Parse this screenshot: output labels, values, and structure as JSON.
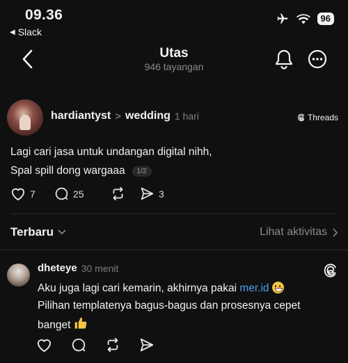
{
  "status_bar": {
    "time": "09.36",
    "back_app": "Slack",
    "battery": "96",
    "icons": [
      "airplane-icon",
      "wifi-icon",
      "battery-icon"
    ]
  },
  "nav": {
    "title": "Utas",
    "subtitle": "946 tayangan",
    "icons": [
      "back-chevron-icon",
      "bell-icon",
      "more-icon"
    ]
  },
  "post": {
    "username": "hardiantyst",
    "separator": ">",
    "topic": "wedding",
    "time_ago": "1 hari",
    "badge": "Threads",
    "line1": "Lagi cari jasa untuk undangan digital nihh,",
    "line2": "Spal spill dong wargaaa",
    "page_indicator": "1/2",
    "likes": "7",
    "comments": "25",
    "shares": "3"
  },
  "replies_header": {
    "sort_label": "Terbaru",
    "activity_label": "Lihat aktivitas"
  },
  "reply": {
    "username": "dheteye",
    "time_ago": "30 menit",
    "line1_text": "Aku juga lagi cari kemarin, akhirnya pakai ",
    "line1_link": "mer.id",
    "line2": "Pilihan templatenya bagus-bagus dan prosesnya cepet",
    "line3": "banget"
  },
  "colors": {
    "background": "#101010",
    "text": "#f3f3f3",
    "muted": "#8a8a8a",
    "link": "#4a9fe8",
    "divider": "#2a2a2a"
  }
}
